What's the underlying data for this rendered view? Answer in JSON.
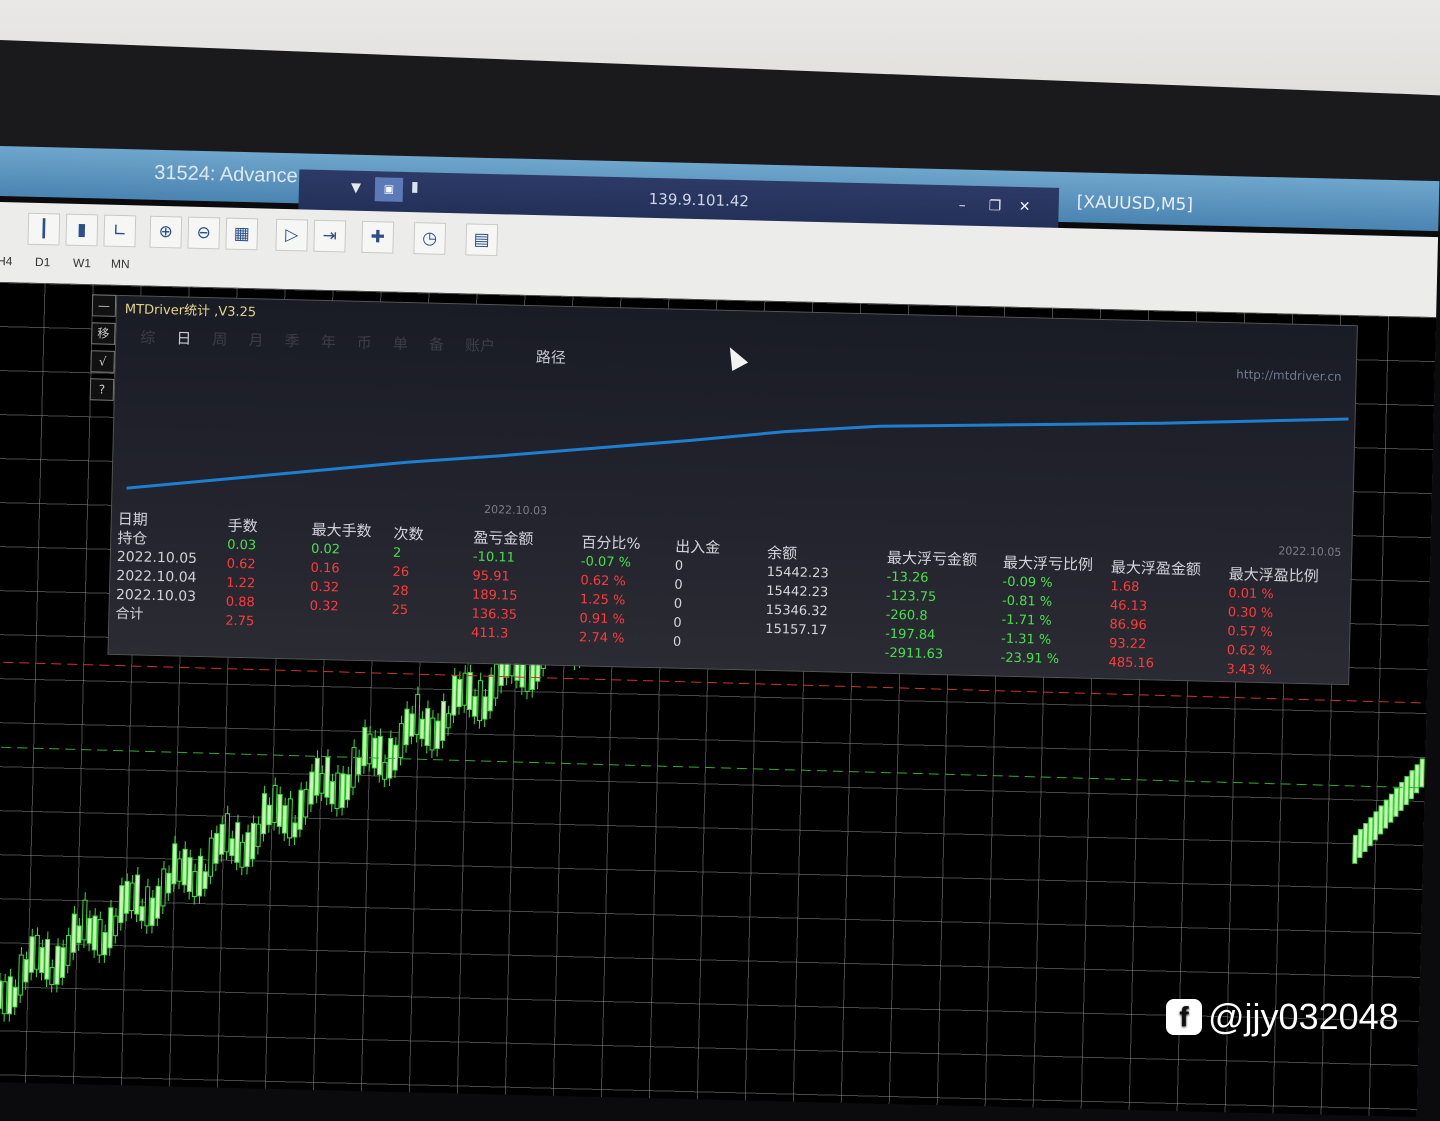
{
  "window": {
    "title": "31524: Advance",
    "remote_ip": "139.9.101.42",
    "symbol": "[XAUUSD,M5]",
    "signal_icon": "signal-bars-icon",
    "app_icon": "app-window-icon"
  },
  "toolbar": {
    "icons": [
      "chart-bars-icon",
      "chart-candles-icon",
      "chart-line-icon",
      "zoom-in-icon",
      "zoom-out-icon",
      "tile-windows-icon",
      "auto-scroll-icon",
      "chart-shift-icon",
      "new-order-icon",
      "clock-icon",
      "templates-icon"
    ],
    "periods": [
      "H4",
      "D1",
      "W1",
      "MN"
    ]
  },
  "side_buttons": [
    "—",
    "移",
    "√",
    "?"
  ],
  "stats_panel": {
    "title": "MTDriver统计 ,V3.25",
    "tabs": [
      "综",
      "日",
      "周",
      "月",
      "季",
      "年",
      "币",
      "单",
      "备",
      "账户"
    ],
    "active_tab": "日",
    "path_label": "路径",
    "url": "http://mtdriver.cn",
    "date_start": "2022.10.03",
    "date_end": "2022.10.05",
    "headers": {
      "date": "日期",
      "position": "持仓",
      "lots": "手数",
      "max_lots": "最大手数",
      "count": "次数",
      "pnl": "盈亏金额",
      "percent": "百分比%",
      "deposit": "出入金",
      "balance": "余额",
      "max_float_loss": "最大浮亏金额",
      "max_float_loss_pct": "最大浮亏比例",
      "max_float_profit": "最大浮盈金额",
      "max_float_profit_pct": "最大浮盈比例"
    },
    "row_labels": [
      "2022.10.05",
      "2022.10.04",
      "2022.10.03",
      "合计"
    ],
    "lots": [
      "0.03",
      "0.62",
      "1.22",
      "0.88",
      "2.75"
    ],
    "max_lots": [
      "0.02",
      "0.16",
      "0.32",
      "0.32"
    ],
    "count": [
      "2",
      "26",
      "28",
      "25"
    ],
    "pnl": [
      "-10.11",
      "95.91",
      "189.15",
      "136.35",
      "411.3"
    ],
    "percent": [
      "-0.07 %",
      "0.62 %",
      "1.25 %",
      "0.91 %",
      "2.74 %"
    ],
    "deposit": [
      "0",
      "0",
      "0",
      "0",
      "0"
    ],
    "balance": [
      "15442.23",
      "15442.23",
      "15346.32",
      "15157.17"
    ],
    "max_float_loss": [
      "-13.26",
      "-123.75",
      "-260.8",
      "-197.84",
      "-2911.63"
    ],
    "max_float_loss_pct": [
      "-0.09 %",
      "-0.81 %",
      "-1.71 %",
      "-1.31 %",
      "-23.91 %"
    ],
    "max_float_profit": [
      "1.68",
      "46.13",
      "86.96",
      "93.22",
      "485.16"
    ],
    "max_float_profit_pct": [
      "0.01 %",
      "0.30 %",
      "0.57 %",
      "0.62 %",
      "3.43 %"
    ]
  },
  "equity_curve": {
    "color": "#1e7fd0",
    "points": [
      0,
      0.1,
      0.2,
      0.3,
      0.38,
      0.47,
      0.56,
      0.66,
      0.73,
      0.76,
      0.79,
      0.82,
      0.86,
      0.9
    ]
  },
  "watermark": "@jjy032048",
  "colors": {
    "profit": "#ff3b3b",
    "loss": "#48e14a",
    "bull_candle": "#3ee03a"
  }
}
